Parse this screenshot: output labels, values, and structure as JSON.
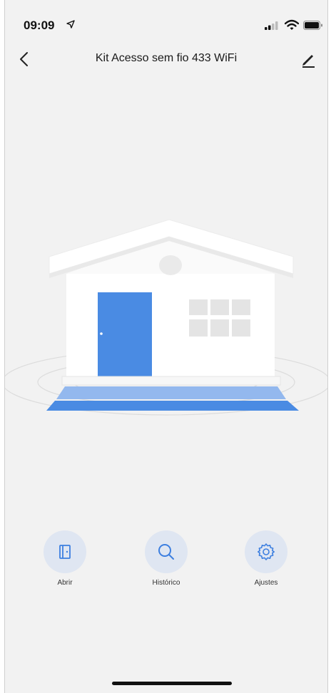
{
  "status_bar": {
    "time": "09:09",
    "icons": [
      "location-arrow-icon",
      "signal-icon",
      "wifi-icon",
      "battery-icon"
    ]
  },
  "nav": {
    "title": "Kit Acesso sem fio 433 WiFi",
    "left_icon": "chevron-left-icon",
    "right_icon": "edit-pencil-icon"
  },
  "illustration": {
    "name": "house-illustration",
    "colors": {
      "door": "#4a8be3",
      "path": "#4a8be3",
      "walls": "#ffffff",
      "windows": "#e4e4e4"
    }
  },
  "actions": [
    {
      "label": "Abrir",
      "icon": "door-icon"
    },
    {
      "label": "Histórico",
      "icon": "search-icon"
    },
    {
      "label": "Ajustes",
      "icon": "gear-icon"
    }
  ],
  "colors": {
    "accent": "#3d7fe0",
    "action_bg": "#dfe6f2",
    "background": "#f2f2f2"
  }
}
